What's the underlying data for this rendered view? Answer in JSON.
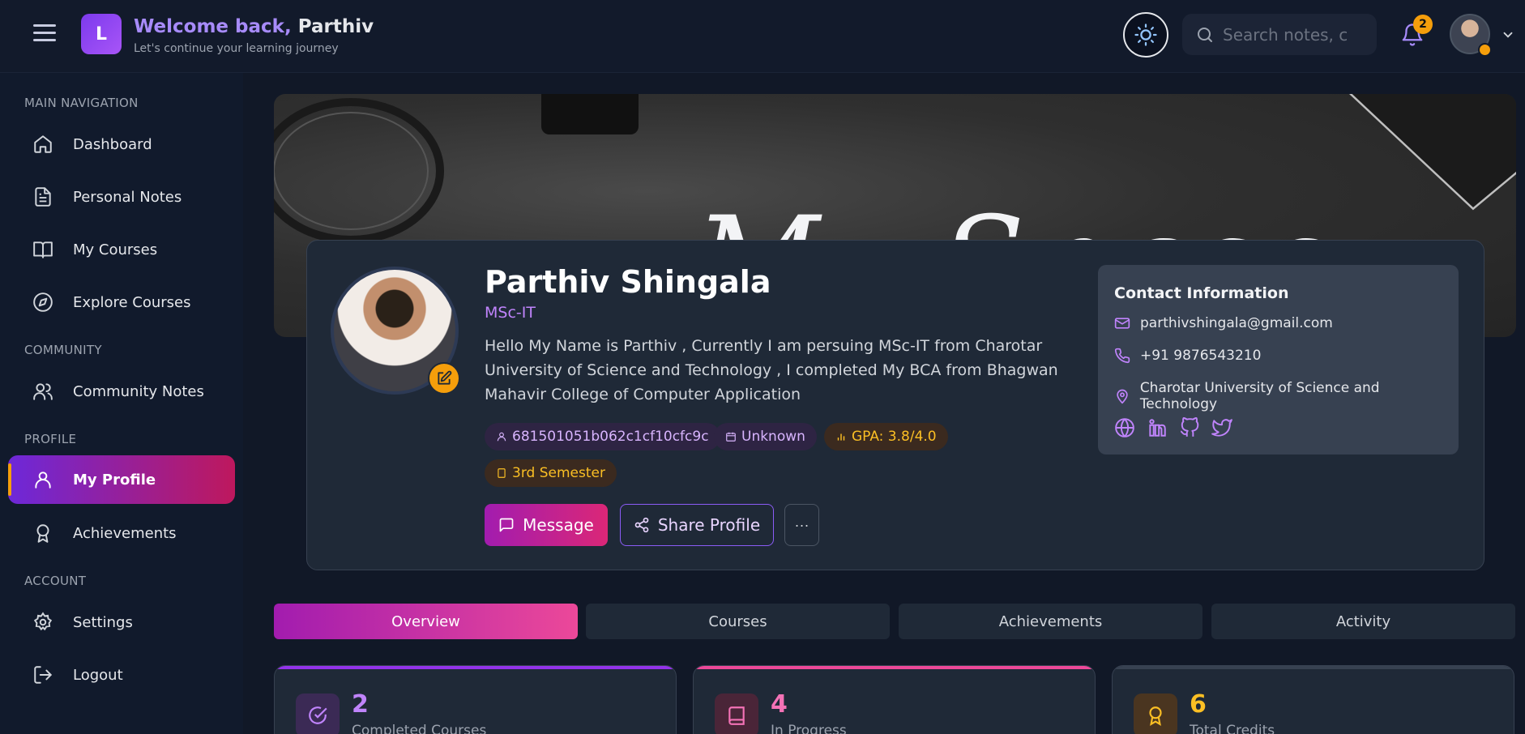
{
  "header": {
    "logo_letter": "L",
    "welcome_prefix": "Welcome back,",
    "welcome_name": "Parthiv",
    "subtitle": "Let's continue your learning journey",
    "search_placeholder": "Search notes, c",
    "notification_count": "2"
  },
  "sidebar": {
    "sections": [
      {
        "title": "MAIN NAVIGATION"
      },
      {
        "title": "COMMUNITY"
      },
      {
        "title": "PROFILE"
      },
      {
        "title": "ACCOUNT"
      }
    ],
    "items": [
      {
        "label": "Dashboard",
        "icon": "home-icon"
      },
      {
        "label": "Personal Notes",
        "icon": "file-text-icon"
      },
      {
        "label": "My Courses",
        "icon": "book-open-icon"
      },
      {
        "label": "Explore Courses",
        "icon": "compass-icon"
      },
      {
        "label": "Community Notes",
        "icon": "users-icon"
      },
      {
        "label": "My Profile",
        "icon": "user-icon",
        "active": true
      },
      {
        "label": "Achievements",
        "icon": "award-icon"
      },
      {
        "label": "Settings",
        "icon": "gear-icon"
      },
      {
        "label": "Logout",
        "icon": "logout-icon"
      }
    ]
  },
  "banner": {
    "text": "My Space"
  },
  "profile": {
    "name": "Parthiv Shingala",
    "program": "MSc-IT",
    "bio": "Hello My Name is Parthiv , Currently I am persuing MSc-IT from Charotar University of Science and Technology , I completed My BCA from Bhagwan Mahavir College of Computer Application",
    "id_tag": "681501051b062c1cf10cfc9c",
    "date_tag": "Unknown",
    "gpa_tag": "GPA: 3.8/4.0",
    "semester_tag": "3rd Semester",
    "message_label": "Message",
    "share_label": "Share Profile",
    "more_label": "···"
  },
  "contact": {
    "title": "Contact Information",
    "email": "parthivshingala@gmail.com",
    "phone": "+91 9876543210",
    "location": "Charotar University of Science and Technology"
  },
  "tabs": [
    {
      "label": "Overview",
      "active": true
    },
    {
      "label": "Courses"
    },
    {
      "label": "Achievements"
    },
    {
      "label": "Activity"
    }
  ],
  "stats": [
    {
      "value": "2",
      "label": "Completed Courses",
      "color": "#c084fc"
    },
    {
      "value": "4",
      "label": "In Progress",
      "color": "#f472b6"
    },
    {
      "value": "6",
      "label": "Total Credits",
      "color": "#fbbf24"
    }
  ],
  "colors": {
    "accent_purple": "#a855f7",
    "accent_pink": "#ec4899",
    "accent_orange": "#f59e0b",
    "background": "#111827"
  }
}
